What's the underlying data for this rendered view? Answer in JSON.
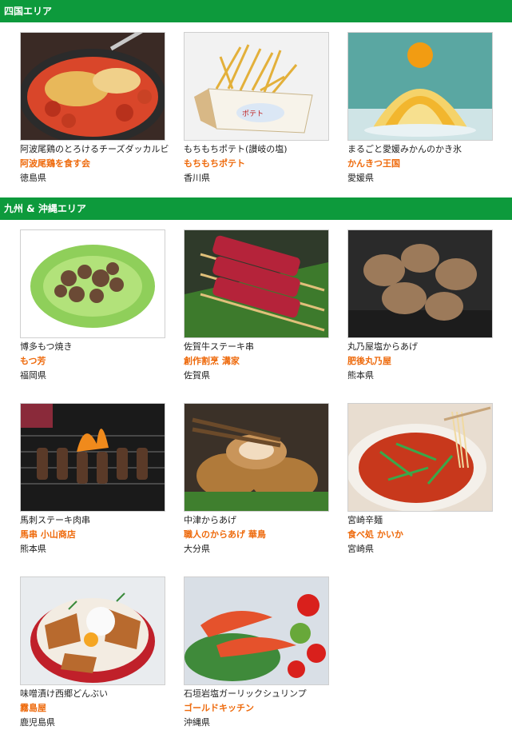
{
  "sections": [
    {
      "title": "四国エリア"
    },
    {
      "title": "九州 & 沖縄エリア"
    }
  ],
  "items": [
    {
      "dish": "阿波尾鶏のとろけるチーズダッカルビ",
      "shop": "阿波尾鶏を食す会",
      "pref": "徳島県",
      "icon": "dakgalbi-photo"
    },
    {
      "dish": "もちもちポテト(讃岐の塩)",
      "shop": "もちもちポテト",
      "pref": "香川県",
      "icon": "potato-photo"
    },
    {
      "dish": "まるごと愛媛みかんのかき氷",
      "shop": "かんきつ王国",
      "pref": "愛媛県",
      "icon": "shaved-ice-photo"
    },
    {
      "dish": "博多もつ焼き",
      "shop": "もつ芳",
      "pref": "福岡県",
      "icon": "motsu-photo"
    },
    {
      "dish": "佐賀牛ステーキ串",
      "shop": "創作割烹 溝家",
      "pref": "佐賀県",
      "icon": "beef-skewer-photo"
    },
    {
      "dish": "丸乃屋塩からあげ",
      "shop": "肥後丸乃屋",
      "pref": "熊本県",
      "icon": "karaage-photo"
    },
    {
      "dish": "馬刺ステーキ肉串",
      "shop": "馬串 小山商店",
      "pref": "熊本県",
      "icon": "grill-skewer-photo"
    },
    {
      "dish": "中津からあげ",
      "shop": "職人のからあげ 華鳥",
      "pref": "大分県",
      "icon": "fried-chicken-photo"
    },
    {
      "dish": "宮崎辛麺",
      "shop": "食べ処 かいか",
      "pref": "宮崎県",
      "icon": "noodle-photo"
    },
    {
      "dish": "味噌漬け西郷どんぶい",
      "shop": "霧島屋",
      "pref": "鹿児島県",
      "icon": "donburi-photo"
    },
    {
      "dish": "石垣岩塩ガーリックシュリンプ",
      "shop": "ゴールドキッチン",
      "pref": "沖縄県",
      "icon": "shrimp-photo"
    }
  ],
  "colors": {
    "header_bg": "#0d9a3c",
    "shop_text": "#ee6a0c"
  }
}
